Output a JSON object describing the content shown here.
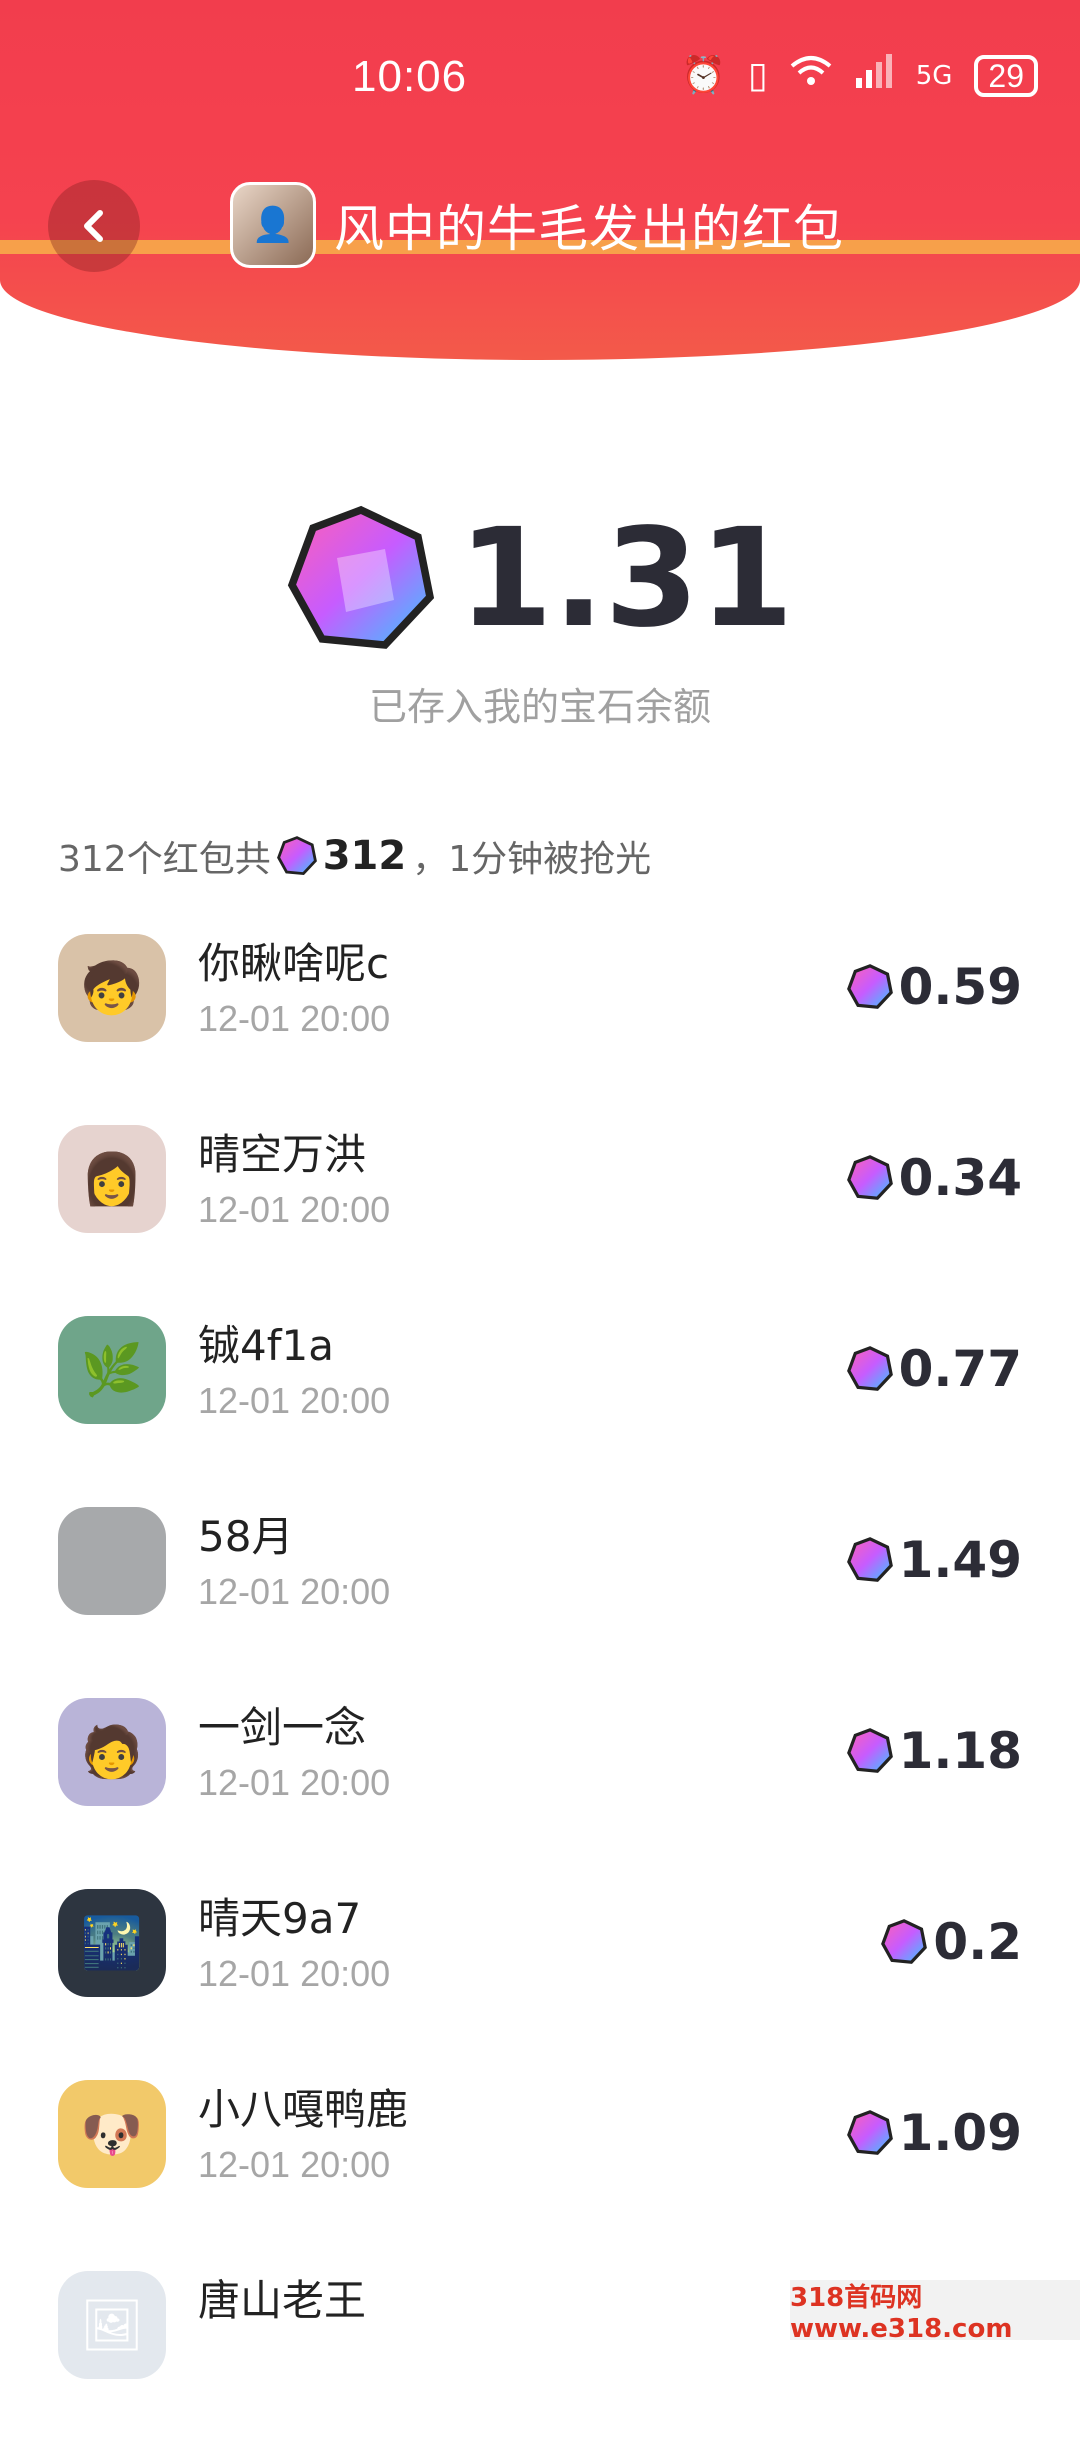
{
  "status": {
    "time": "10:06",
    "battery": "29",
    "network": "5G"
  },
  "header": {
    "title": "风中的牛毛发出的红包"
  },
  "amount": {
    "value": "1.31",
    "caption": "已存入我的宝石余额"
  },
  "summary": {
    "prefix": "312个红包共",
    "total": "312",
    "suffix": "，1分钟被抢光"
  },
  "records": [
    {
      "name": "你瞅啥呢c",
      "time": "12-01 20:00",
      "amount": "0.59",
      "avatar_color": "#d9c2a8"
    },
    {
      "name": "晴空万洪",
      "time": "12-01 20:00",
      "amount": "0.34",
      "avatar_color": "#e6d3cf"
    },
    {
      "name": "铖4f1a",
      "time": "12-01 20:00",
      "amount": "0.77",
      "avatar_color": "#6fa58a"
    },
    {
      "name": "58月",
      "time": "12-01 20:00",
      "amount": "1.49",
      "avatar_color": "#a7a9ab"
    },
    {
      "name": "一剑一念",
      "time": "12-01 20:00",
      "amount": "1.18",
      "avatar_color": "#b9b4d8"
    },
    {
      "name": "晴天9a7",
      "time": "12-01 20:00",
      "amount": "0.2",
      "avatar_color": "#2d3540"
    },
    {
      "name": "小八嘎鸭鹿",
      "time": "12-01 20:00",
      "amount": "1.09",
      "avatar_color": "#f2c96a"
    },
    {
      "name": "唐山老王",
      "time": "",
      "amount": "",
      "avatar_color": "#e3e8ee"
    }
  ],
  "watermark": "318首码网 www.e318.com"
}
